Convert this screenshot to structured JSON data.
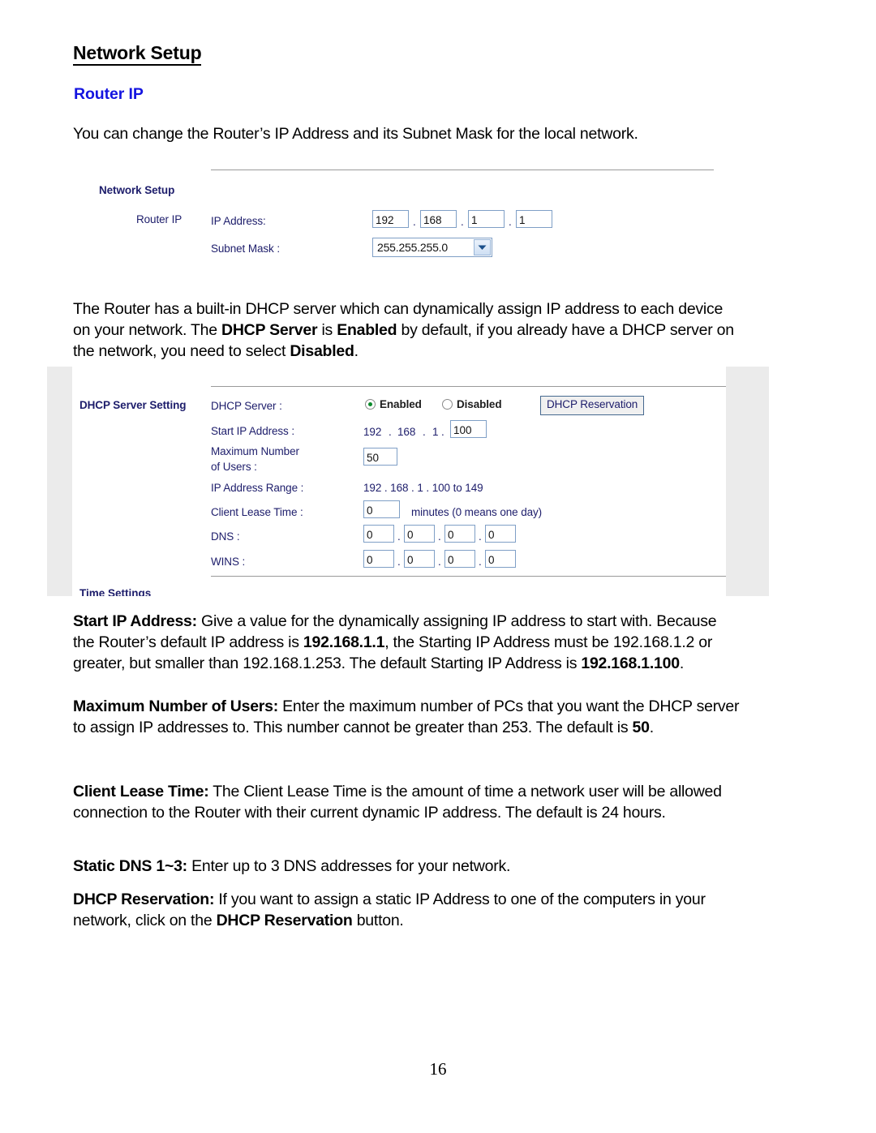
{
  "document": {
    "title": "Network Setup",
    "section_heading": "Router IP",
    "section_heading_color": "#1414e0",
    "page_number": "16",
    "intro_paragraph": "You can change the Router’s IP Address and its Subnet Mask for the local network.",
    "paragraphs": [
      {
        "id": "dhcp-intro",
        "runs": [
          {
            "text": "The Router has a built-in DHCP server which can dynamically assign IP address to each device on your network. The ",
            "bold": false
          },
          {
            "text": "DHCP Server",
            "bold": true
          },
          {
            "text": " is ",
            "bold": false
          },
          {
            "text": "Enabled",
            "bold": true
          },
          {
            "text": " by default, if you already have a DHCP server on the network, you need to select ",
            "bold": false
          },
          {
            "text": "Disabled",
            "bold": true
          },
          {
            "text": ".",
            "bold": false
          }
        ]
      },
      {
        "id": "start-ip-address",
        "runs": [
          {
            "text": "Start IP Address:",
            "bold": true
          },
          {
            "text": " Give a value for the dynamically assigning IP address to start with. Because the Router’s default IP address is ",
            "bold": false
          },
          {
            "text": "192.168.1.1",
            "bold": true
          },
          {
            "text": ", the Starting IP Address must be 192.168.1.2 or greater, but smaller than 192.168.1.253. The default Starting IP Address is ",
            "bold": false
          },
          {
            "text": "192.168.1.100",
            "bold": true
          },
          {
            "text": ".",
            "bold": false
          }
        ]
      },
      {
        "id": "maximum-number-of-users",
        "runs": [
          {
            "text": "Maximum Number of Users:",
            "bold": true
          },
          {
            "text": " Enter the maximum number of PCs that you want the DHCP server to assign IP addresses to. This number cannot be greater than 253. The default is ",
            "bold": false
          },
          {
            "text": "50",
            "bold": true
          },
          {
            "text": ".",
            "bold": false
          }
        ]
      },
      {
        "id": "client-lease-time",
        "runs": [
          {
            "text": "Client Lease Time:",
            "bold": true
          },
          {
            "text": " The Client Lease Time is the amount of time a network user will be allowed connection to the Router with their current dynamic IP address. The default is 24 hours.",
            "bold": false
          }
        ]
      },
      {
        "id": "static-dns",
        "runs": [
          {
            "text": "Static DNS 1~3:",
            "bold": true
          },
          {
            "text": " Enter up to 3 DNS addresses for your network.",
            "bold": false
          }
        ]
      },
      {
        "id": "dhcp-reservation",
        "runs": [
          {
            "text": "DHCP Reservation:",
            "bold": true
          },
          {
            "text": " If you want to assign a static IP Address to one of the computers in your network, click on the ",
            "bold": false
          },
          {
            "text": "DHCP Reservation",
            "bold": true
          },
          {
            "text": " button.",
            "bold": false
          }
        ]
      }
    ]
  },
  "screenshot_network_setup": {
    "section_label": "Network Setup",
    "row_label": "Router IP",
    "ip_address": {
      "label": "IP Address:",
      "octets": [
        "192",
        "168",
        "1",
        "1"
      ],
      "separator": "."
    },
    "subnet_mask": {
      "label": "Subnet Mask :",
      "selected": "255.255.255.0"
    }
  },
  "screenshot_dhcp": {
    "section_label": "DHCP Server Setting",
    "dhcp_server": {
      "label": "DHCP Server :",
      "options": [
        "Enabled",
        "Disabled"
      ],
      "selected": "Enabled",
      "reservation_button": "DHCP Reservation"
    },
    "start_ip_address": {
      "label": "Start IP Address :",
      "prefix": [
        "192",
        "168",
        "1"
      ],
      "separator": ".",
      "value": "100"
    },
    "maximum_users": {
      "label_line1": "Maximum Number",
      "label_line2": " of Users :",
      "value": "50"
    },
    "ip_address_range": {
      "label": "IP Address Range :",
      "value": "192 .  168 .  1 .  100 to 149"
    },
    "client_lease_time": {
      "label": "Client Lease Time :",
      "value": "0",
      "hint": "minutes (0 means one day)"
    },
    "dns": {
      "label": "DNS :",
      "octets": [
        "0",
        "0",
        "0",
        "0"
      ],
      "separator": "."
    },
    "wins": {
      "label": "WINS :",
      "octets": [
        "0",
        "0",
        "0",
        "0"
      ],
      "separator": "."
    },
    "next_section_label": "Time Settings"
  }
}
